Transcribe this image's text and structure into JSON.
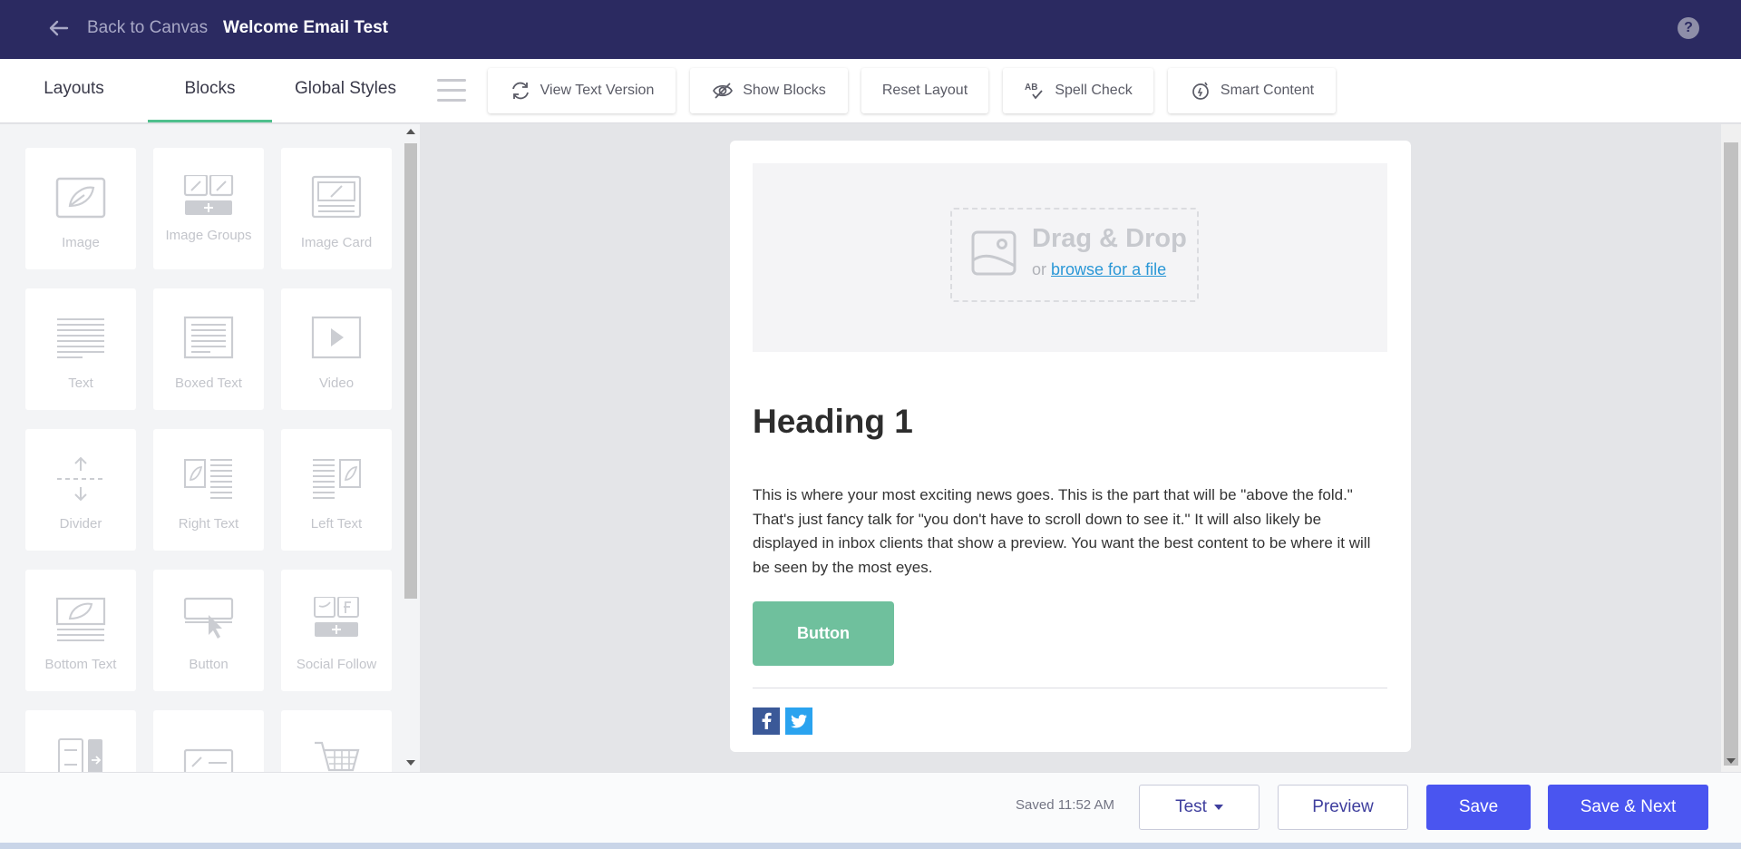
{
  "header": {
    "back_label": "Back to Canvas",
    "title": "Welcome Email Test",
    "help_label": "?"
  },
  "tabs": [
    {
      "label": "Layouts",
      "active": false
    },
    {
      "label": "Blocks",
      "active": true
    },
    {
      "label": "Global Styles",
      "active": false
    }
  ],
  "toolbar": {
    "view_text_version": "View Text Version",
    "show_blocks": "Show Blocks",
    "reset_layout": "Reset Layout",
    "spell_check": "Spell Check",
    "spell_check_icon_text": "AB",
    "smart_content": "Smart Content"
  },
  "blocks": [
    {
      "label": "Image",
      "icon": "image-icon"
    },
    {
      "label": "Image Groups",
      "icon": "image-groups-icon"
    },
    {
      "label": "Image Card",
      "icon": "image-card-icon"
    },
    {
      "label": "Text",
      "icon": "text-icon"
    },
    {
      "label": "Boxed Text",
      "icon": "boxed-text-icon"
    },
    {
      "label": "Video",
      "icon": "video-icon"
    },
    {
      "label": "Divider",
      "icon": "divider-icon"
    },
    {
      "label": "Right Text",
      "icon": "right-text-icon"
    },
    {
      "label": "Left Text",
      "icon": "left-text-icon"
    },
    {
      "label": "Bottom Text",
      "icon": "bottom-text-icon"
    },
    {
      "label": "Button",
      "icon": "button-icon"
    },
    {
      "label": "Social Follow",
      "icon": "social-follow-icon"
    },
    {
      "label": "",
      "icon": "social-share-icon"
    },
    {
      "label": "",
      "icon": "footer-icon"
    },
    {
      "label": "",
      "icon": "cart-icon"
    }
  ],
  "canvas": {
    "dropzone": {
      "title": "Drag & Drop",
      "or_text": "or",
      "link_text": "browse for a file"
    },
    "heading": "Heading 1",
    "body": "This is where your most exciting news goes. This is the part that will be \"above the fold.\" That's just fancy talk for \"you don't have to scroll down to see it.\" It will also likely be displayed in inbox clients that show a preview. You want the best content to be where it will be seen by the most eyes.",
    "button_label": "Button",
    "social": [
      "facebook-icon",
      "twitter-icon"
    ]
  },
  "footer": {
    "saved_text": "Saved 11:52 AM",
    "test_label": "Test",
    "preview_label": "Preview",
    "save_label": "Save",
    "save_next_label": "Save & Next"
  },
  "colors": {
    "header_bg": "#2b2a61",
    "tab_active": "#4fc08d",
    "primary_button": "#4a55f0",
    "email_button": "#6fc09d",
    "link": "#2a97d6",
    "facebook": "#3b5998",
    "twitter": "#2aa3ef"
  }
}
